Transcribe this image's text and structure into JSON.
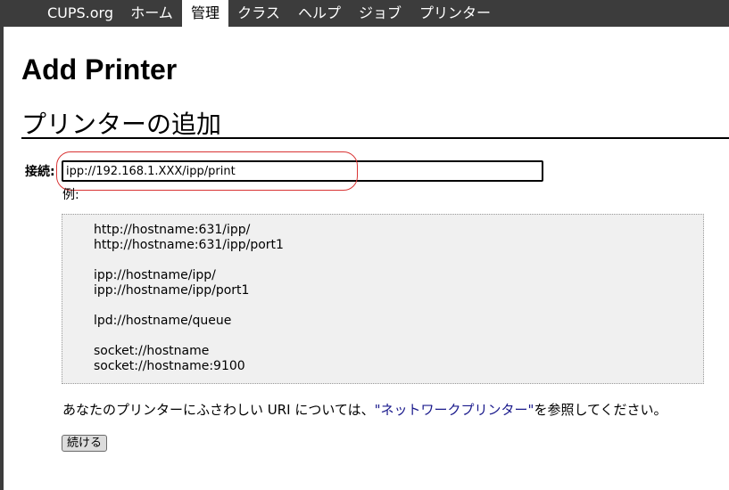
{
  "nav": {
    "items": [
      {
        "label": "CUPS.org",
        "active": false
      },
      {
        "label": "ホーム",
        "active": false
      },
      {
        "label": "管理",
        "active": true
      },
      {
        "label": "クラス",
        "active": false
      },
      {
        "label": "ヘルプ",
        "active": false
      },
      {
        "label": "ジョブ",
        "active": false
      },
      {
        "label": "プリンター",
        "active": false
      }
    ]
  },
  "page": {
    "title": "Add Printer",
    "heading": "プリンターの追加"
  },
  "form": {
    "connection_label": "接続:",
    "connection_value": "ipp://192.168.1.XXX/ipp/print",
    "example_label": "例:",
    "examples": [
      "http://hostname:631/ipp/",
      "http://hostname:631/ipp/port1",
      "ipp://hostname/ipp/",
      "ipp://hostname/ipp/port1",
      "lpd://hostname/queue",
      "socket://hostname",
      "socket://hostname:9100"
    ],
    "help_prefix": "あなたのプリンターにふさわしい URI については、",
    "help_link": "\"ネットワークプリンター\"",
    "help_suffix": "を参照してください。",
    "continue_label": "続ける"
  },
  "colors": {
    "navbar": "#3c3c3c",
    "link": "#1a1a8c",
    "annotation": "#d93434"
  }
}
